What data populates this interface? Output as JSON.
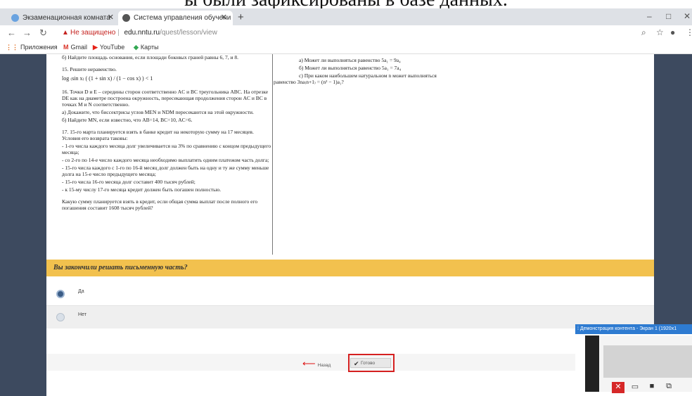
{
  "caption": "ы были зафиксированы в базе данных.",
  "tabs": [
    {
      "label": "Экзаменационная комната",
      "active": false
    },
    {
      "label": "Система управления обучени",
      "active": true
    }
  ],
  "address": {
    "security": "Не защищено",
    "host": "edu.nntu.ru",
    "path": "/quest/lesson/view"
  },
  "bookmarks": [
    "Приложения",
    "Gmail",
    "YouTube",
    "Карты"
  ],
  "left_column": {
    "q14_tail": "б) Найдите площадь основания, если площади боковых граней равны 6, 7, и 8.",
    "q15_title": "15. Решите неравенство.",
    "q15_formula": "log ₍sin x₎ ( (1 + sin x) / (1 − cos x) ) < 1",
    "q16": "16. Точки D и E – середины сторон соответственно AC и BC треугольника ABC. На отрезке DE как на диаметре построена окружность, пересекающая продолжения сторон AC и BC в точках M и N соответственно.",
    "q16_a": "а) Докажите, что биссектрисы углов MEN и NDM пересекаются на этой окружности.",
    "q16_b": "б) Найдите MN, если известно, что AB=14, BC=10, AC=6.",
    "q17_intro": "17. 15-го марта планируется взять в банке кредит на некоторую сумму на 17 месяцев. Условия его возврата таковы:",
    "q17_items": [
      "- 1-го числа каждого месяца долг увеличивается на 3% по сравнению с концом предыдущего месяца;",
      "- со 2-го по 14-е число каждого месяца необходимо выплатить одним платежом часть долга;",
      "- 15-го числа каждого с 1-го по 16-й месяц долг должен быть на одну и ту же сумму меньше долга на 15-е число предыдущего месяца;",
      "- 15-го числа 16-го месяца долг составит 400 тысяч рублей;",
      "- к 15-му числу 17-го месяца кредит должен быть погашен полностью."
    ],
    "q17_question": "Какую сумму планируется взять в кредит, если общая сумма выплат после полного его погашения составит 1608 тысяч рублей?"
  },
  "right_column": {
    "a": "а) Может ли выполняться равенство 5a₁ = 9a₄",
    "b": "б) Может ли выполняться равенство 5a₁ = 7a₄",
    "c": "с) При каком наибольшем натуральном n может выполняться",
    "c2": "равенство 3na₍n+1₎ = (n² − 1)a₁?"
  },
  "question": "Вы закончили решать письменную часть?",
  "options": [
    {
      "label": "Да",
      "selected": true
    },
    {
      "label": "Нет",
      "selected": false
    }
  ],
  "buttons": {
    "back": "Назад",
    "ready": "Готово"
  },
  "share": {
    "title": "Демонстрация контента - Экран 1 (1920x1"
  },
  "colors": {
    "page_bg": "#3d4a5f",
    "question_bar": "#f2c14e",
    "highlight": "#d52020",
    "share_bar": "#2e7bd1"
  }
}
